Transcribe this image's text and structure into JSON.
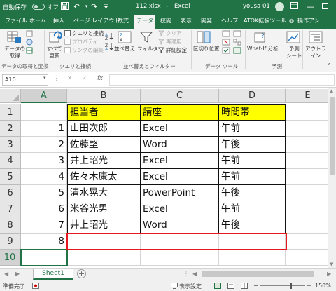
{
  "titlebar": {
    "autosave_label": "自動保存",
    "autosave_state": "オフ",
    "file_name": "112.xlsx",
    "separator": "-",
    "app_name": "Excel",
    "user_name": "yousa 01"
  },
  "tabs": [
    "ファイル",
    "ホーム",
    "挿入",
    "ページ レイアウト",
    "数式",
    "データ",
    "校閲",
    "表示",
    "開発",
    "ヘルプ",
    "ATOK拡張ツール",
    "操作アシ"
  ],
  "active_tab": "データ",
  "ribbon": {
    "get_data": "データの\n取得",
    "refresh_all": "すべて\n更新",
    "queries_connections": "クエリと接続",
    "properties": "プロパティ",
    "edit_links": "リンクの編集",
    "sort": "並べ替え",
    "filter": "フィルター",
    "clear": "クリア",
    "reapply": "再適用",
    "advanced": "詳細設定",
    "text_to_columns": "区切り位置",
    "what_if": "What-If 分析",
    "forecast_sheet": "予測\nシート",
    "outline": "アウトラ\nイン",
    "groups": {
      "get_transform": "データの取得と変換",
      "queries": "クエリと接続",
      "sort_filter": "並べ替えとフィルター",
      "data_tools": "データ ツール",
      "forecast": "予測"
    }
  },
  "formula_bar": {
    "name_box": "A10",
    "fx_label": "fx",
    "value": ""
  },
  "columns": [
    "A",
    "B",
    "C",
    "D",
    "E"
  ],
  "rows": [
    "1",
    "2",
    "3",
    "4",
    "5",
    "6",
    "7",
    "8",
    "9",
    "10"
  ],
  "table": {
    "headers": [
      "担当者",
      "講座",
      "時間帯"
    ],
    "records": [
      {
        "no": "1",
        "name": "山田次郎",
        "course": "Excel",
        "time": "午前"
      },
      {
        "no": "2",
        "name": "佐藤堅",
        "course": "Word",
        "time": "午後"
      },
      {
        "no": "3",
        "name": "井上昭光",
        "course": "Excel",
        "time": "午前"
      },
      {
        "no": "4",
        "name": "佐々木康太",
        "course": "Excel",
        "time": "午前"
      },
      {
        "no": "5",
        "name": "清水晃大",
        "course": "PowerPoint",
        "time": "午後"
      },
      {
        "no": "6",
        "name": "米谷光男",
        "course": "Excel",
        "time": "午前"
      },
      {
        "no": "7",
        "name": "井上昭光",
        "course": "Word",
        "time": "午後"
      },
      {
        "no": "8",
        "name": "",
        "course": "",
        "time": ""
      }
    ]
  },
  "sheet_tabs": [
    "Sheet1"
  ],
  "statusbar": {
    "ready": "準備完了",
    "display_settings": "表示設定",
    "zoom": "150%"
  },
  "colors": {
    "excel_green": "#217346",
    "header_fill": "#ffff00",
    "highlight_red": "#e8191e"
  }
}
